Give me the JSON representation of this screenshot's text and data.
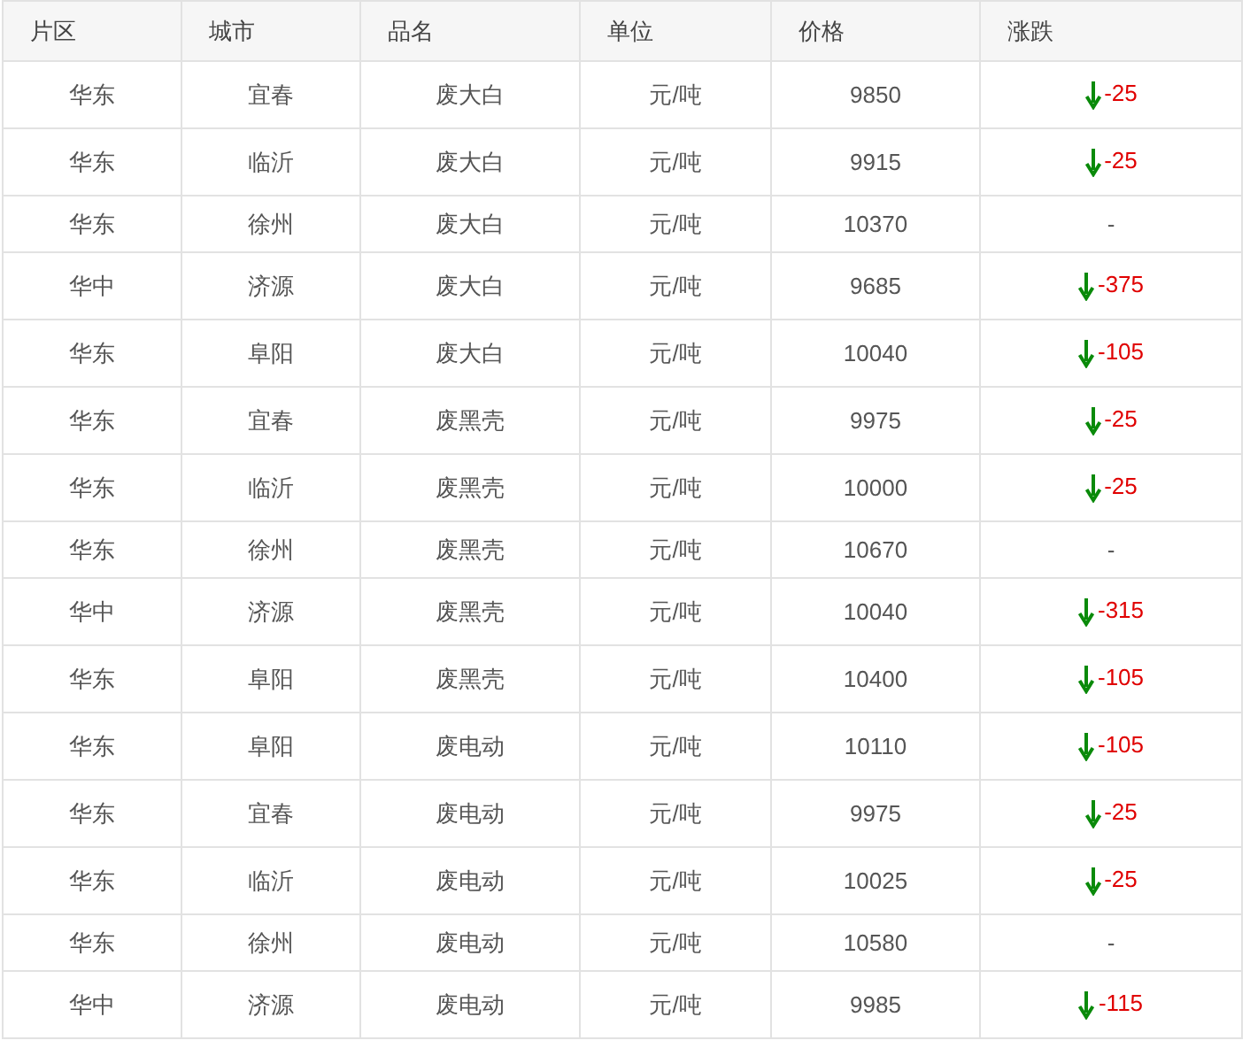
{
  "table": {
    "columns": [
      "片区",
      "城市",
      "品名",
      "单位",
      "价格",
      "涨跌"
    ],
    "rows": [
      {
        "region": "华东",
        "city": "宜春",
        "product": "废大白",
        "unit": "元/吨",
        "price": "9850",
        "kind": "down",
        "change": "-25"
      },
      {
        "region": "华东",
        "city": "临沂",
        "product": "废大白",
        "unit": "元/吨",
        "price": "9915",
        "kind": "down",
        "change": "-25"
      },
      {
        "region": "华东",
        "city": "徐州",
        "product": "废大白",
        "unit": "元/吨",
        "price": "10370",
        "kind": "flat",
        "change": "-"
      },
      {
        "region": "华中",
        "city": "济源",
        "product": "废大白",
        "unit": "元/吨",
        "price": "9685",
        "kind": "down",
        "change": "-375"
      },
      {
        "region": "华东",
        "city": "阜阳",
        "product": "废大白",
        "unit": "元/吨",
        "price": "10040",
        "kind": "down",
        "change": "-105"
      },
      {
        "region": "华东",
        "city": "宜春",
        "product": "废黑壳",
        "unit": "元/吨",
        "price": "9975",
        "kind": "down",
        "change": "-25"
      },
      {
        "region": "华东",
        "city": "临沂",
        "product": "废黑壳",
        "unit": "元/吨",
        "price": "10000",
        "kind": "down",
        "change": "-25"
      },
      {
        "region": "华东",
        "city": "徐州",
        "product": "废黑壳",
        "unit": "元/吨",
        "price": "10670",
        "kind": "flat",
        "change": "-"
      },
      {
        "region": "华中",
        "city": "济源",
        "product": "废黑壳",
        "unit": "元/吨",
        "price": "10040",
        "kind": "down",
        "change": "-315"
      },
      {
        "region": "华东",
        "city": "阜阳",
        "product": "废黑壳",
        "unit": "元/吨",
        "price": "10400",
        "kind": "down",
        "change": "-105"
      },
      {
        "region": "华东",
        "city": "阜阳",
        "product": "废电动",
        "unit": "元/吨",
        "price": "10110",
        "kind": "down",
        "change": "-105"
      },
      {
        "region": "华东",
        "city": "宜春",
        "product": "废电动",
        "unit": "元/吨",
        "price": "9975",
        "kind": "down",
        "change": "-25"
      },
      {
        "region": "华东",
        "city": "临沂",
        "product": "废电动",
        "unit": "元/吨",
        "price": "10025",
        "kind": "down",
        "change": "-25"
      },
      {
        "region": "华东",
        "city": "徐州",
        "product": "废电动",
        "unit": "元/吨",
        "price": "10580",
        "kind": "flat",
        "change": "-"
      },
      {
        "region": "华中",
        "city": "济源",
        "product": "废电动",
        "unit": "元/吨",
        "price": "9985",
        "kind": "down",
        "change": "-115"
      }
    ]
  }
}
